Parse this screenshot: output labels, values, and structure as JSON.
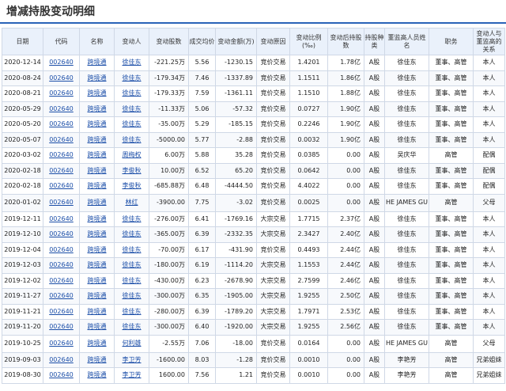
{
  "page": {
    "title": "增减持股变动明细"
  },
  "table": {
    "headers": [
      "日期",
      "代码",
      "名称",
      "变动人",
      "变动股数",
      "成交均价",
      "变动金额(万)",
      "变动原因",
      "变动比例(‰)",
      "变动后持股数",
      "持股种类",
      "董监高人员姓名",
      "职务",
      "变动人与董监高的关系"
    ],
    "rows": [
      [
        "2020-12-14",
        "002640",
        "跨境通",
        "徐佳东",
        "-221.25万",
        "5.56",
        "-1230.15",
        "竞价交易",
        "1.4201",
        "1.78亿",
        "A股",
        "徐佳东",
        "董事、高管",
        "本人"
      ],
      [
        "2020-08-24",
        "002640",
        "跨境通",
        "徐佳东",
        "-179.34万",
        "7.46",
        "-1337.89",
        "竞价交易",
        "1.1511",
        "1.86亿",
        "A股",
        "徐佳东",
        "董事、高管",
        "本人"
      ],
      [
        "2020-08-21",
        "002640",
        "跨境通",
        "徐佳东",
        "-179.33万",
        "7.59",
        "-1361.11",
        "竞价交易",
        "1.1510",
        "1.88亿",
        "A股",
        "徐佳东",
        "董事、高管",
        "本人"
      ],
      [
        "2020-05-29",
        "002640",
        "跨境通",
        "徐佳东",
        "-11.33万",
        "5.06",
        "-57.32",
        "竞价交易",
        "0.0727",
        "1.90亿",
        "A股",
        "徐佳东",
        "董事、高管",
        "本人"
      ],
      [
        "2020-05-20",
        "002640",
        "跨境通",
        "徐佳东",
        "-35.00万",
        "5.29",
        "-185.15",
        "竞价交易",
        "0.2246",
        "1.90亿",
        "A股",
        "徐佳东",
        "董事、高管",
        "本人"
      ],
      [
        "2020-05-07",
        "002640",
        "跨境通",
        "徐佳东",
        "-5000.00",
        "5.77",
        "-2.88",
        "竞价交易",
        "0.0032",
        "1.90亿",
        "A股",
        "徐佳东",
        "董事、高管",
        "本人"
      ],
      [
        "2020-03-02",
        "002640",
        "跨境通",
        "周梅权",
        "6.00万",
        "5.88",
        "35.28",
        "竞价交易",
        "0.0385",
        "0.00",
        "A股",
        "吴庆华",
        "高管",
        "配偶"
      ],
      [
        "2020-02-18",
        "002640",
        "跨境通",
        "李俊秋",
        "10.00万",
        "6.52",
        "65.20",
        "竞价交易",
        "0.0642",
        "0.00",
        "A股",
        "徐佳东",
        "董事、高管",
        "配偶"
      ],
      [
        "2020-02-18",
        "002640",
        "跨境通",
        "李俊秋",
        "-685.88万",
        "6.48",
        "-4444.50",
        "竞价交易",
        "4.4022",
        "0.00",
        "A股",
        "徐佳东",
        "董事、高管",
        "配偶"
      ],
      [
        "2020-01-02",
        "002640",
        "跨境通",
        "林红",
        "-3900.00",
        "7.75",
        "-3.02",
        "竞价交易",
        "0.0025",
        "0.00",
        "A股",
        "HE JAMES GU",
        "高管",
        "父母"
      ],
      [
        "2019-12-11",
        "002640",
        "跨境通",
        "徐佳东",
        "-276.00万",
        "6.41",
        "-1769.16",
        "大宗交易",
        "1.7715",
        "2.37亿",
        "A股",
        "徐佳东",
        "董事、高管",
        "本人"
      ],
      [
        "2019-12-10",
        "002640",
        "跨境通",
        "徐佳东",
        "-365.00万",
        "6.39",
        "-2332.35",
        "大宗交易",
        "2.3427",
        "2.40亿",
        "A股",
        "徐佳东",
        "董事、高管",
        "本人"
      ],
      [
        "2019-12-04",
        "002640",
        "跨境通",
        "徐佳东",
        "-70.00万",
        "6.17",
        "-431.90",
        "竞价交易",
        "0.4493",
        "2.44亿",
        "A股",
        "徐佳东",
        "董事、高管",
        "本人"
      ],
      [
        "2019-12-03",
        "002640",
        "跨境通",
        "徐佳东",
        "-180.00万",
        "6.19",
        "-1114.20",
        "大宗交易",
        "1.1553",
        "2.44亿",
        "A股",
        "徐佳东",
        "董事、高管",
        "本人"
      ],
      [
        "2019-12-02",
        "002640",
        "跨境通",
        "徐佳东",
        "-430.00万",
        "6.23",
        "-2678.90",
        "大宗交易",
        "2.7599",
        "2.46亿",
        "A股",
        "徐佳东",
        "董事、高管",
        "本人"
      ],
      [
        "2019-11-27",
        "002640",
        "跨境通",
        "徐佳东",
        "-300.00万",
        "6.35",
        "-1905.00",
        "大宗交易",
        "1.9255",
        "2.50亿",
        "A股",
        "徐佳东",
        "董事、高管",
        "本人"
      ],
      [
        "2019-11-21",
        "002640",
        "跨境通",
        "徐佳东",
        "-280.00万",
        "6.39",
        "-1789.20",
        "大宗交易",
        "1.7971",
        "2.53亿",
        "A股",
        "徐佳东",
        "董事、高管",
        "本人"
      ],
      [
        "2019-11-20",
        "002640",
        "跨境通",
        "徐佳东",
        "-300.00万",
        "6.40",
        "-1920.00",
        "大宗交易",
        "1.9255",
        "2.56亿",
        "A股",
        "徐佳东",
        "董事、高管",
        "本人"
      ],
      [
        "2019-10-25",
        "002640",
        "跨境通",
        "何利雄",
        "-2.55万",
        "7.06",
        "-18.00",
        "竞价交易",
        "0.0164",
        "0.00",
        "A股",
        "HE JAMES GU",
        "高管",
        "父母"
      ],
      [
        "2019-09-03",
        "002640",
        "跨境通",
        "李卫芳",
        "-1600.00",
        "8.03",
        "-1.28",
        "竞价交易",
        "0.0010",
        "0.00",
        "A股",
        "李艳芳",
        "高管",
        "兄弟姐妹"
      ],
      [
        "2019-08-30",
        "002640",
        "跨境通",
        "李卫芳",
        "1600.00",
        "7.56",
        "1.21",
        "竞价交易",
        "0.0010",
        "0.00",
        "A股",
        "李艳芳",
        "高管",
        "兄弟姐妹"
      ]
    ]
  }
}
